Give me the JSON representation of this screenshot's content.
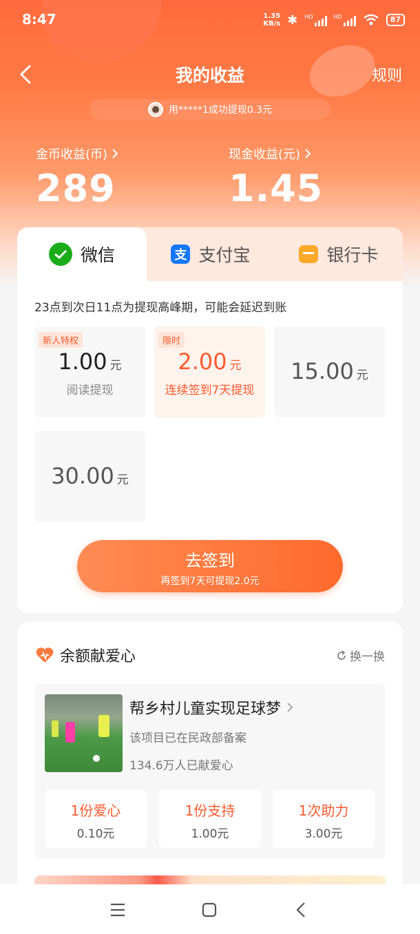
{
  "status": {
    "time": "8:47",
    "net_speed_top": "1.35",
    "net_speed_bottom": "KB/s",
    "battery": "87",
    "hd1": "HD",
    "hd2": "HD"
  },
  "header": {
    "title": "我的收益",
    "rules": "规则"
  },
  "ticker": {
    "text": "用*****1成功提现0.3元"
  },
  "earnings": {
    "coin_label": "金币收益(币)",
    "coin_value": "289",
    "cash_label": "现金收益(元)",
    "cash_value": "1.45"
  },
  "tabs": [
    {
      "label": "微信",
      "icon": "wechat-icon"
    },
    {
      "label": "支付宝",
      "icon": "alipay-icon"
    },
    {
      "label": "银行卡",
      "icon": "bank-card-icon"
    }
  ],
  "notice": "23点到次日11点为提现高峰期，可能会延迟到账",
  "amounts": [
    {
      "tag": "新人特权",
      "value": "1.00",
      "unit": "元",
      "sub": "阅读提现"
    },
    {
      "tag": "限时",
      "value": "2.00",
      "unit": "元",
      "sub": "连续签到7天提现"
    },
    {
      "value": "15.00",
      "unit": "元"
    },
    {
      "value": "30.00",
      "unit": "元"
    }
  ],
  "cta": {
    "main": "去签到",
    "sub": "再签到7天可提现2.0元"
  },
  "charity": {
    "title": "余额献爱心",
    "refresh": "换一换",
    "project": {
      "name": "帮乡村儿童实现足球梦",
      "desc": "该项目已在民政部备案",
      "count": "134.6万人已献爱心"
    },
    "options": [
      {
        "label": "1份爱心",
        "price": "0.10元"
      },
      {
        "label": "1份支持",
        "price": "1.00元"
      },
      {
        "label": "1次助力",
        "price": "3.00元"
      }
    ]
  },
  "colors": {
    "accent": "#ff5a2c",
    "hero": "#ff6a3d",
    "wechat": "#1aad19",
    "alipay": "#1677ff",
    "bank": "#ffa928"
  }
}
